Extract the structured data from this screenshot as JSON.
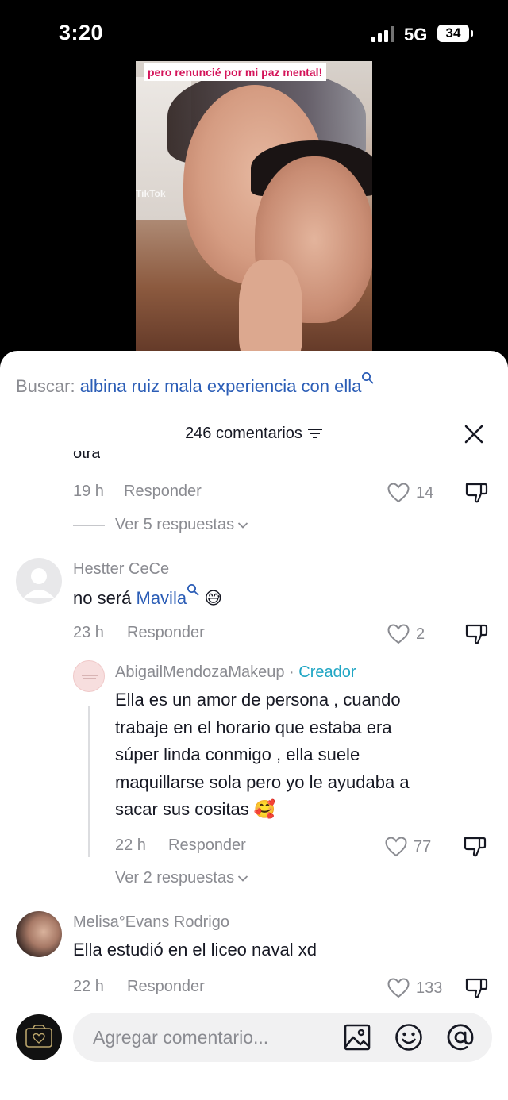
{
  "status_bar": {
    "time": "3:20",
    "network": "5G",
    "battery": "34"
  },
  "video": {
    "banner": "pero renuncié por mi paz mental!",
    "watermark": "TikTok"
  },
  "search": {
    "prefix": "Buscar: ",
    "query": "albina ruiz mala experiencia con ella"
  },
  "header": {
    "count_label": "246 comentarios"
  },
  "comments": {
    "prev": {
      "cut_text": "otra",
      "time": "19 h",
      "reply_label": "Responder",
      "likes": "14",
      "view_replies": "Ver 5 respuestas"
    },
    "c1": {
      "username": "Hestter CeCe",
      "text_before": "no será ",
      "mention": "Mavila",
      "emoji": "😅",
      "time": "23 h",
      "reply_label": "Responder",
      "likes": "2"
    },
    "reply": {
      "username": "AbigailMendozaMakeup",
      "separator": " · ",
      "badge": "Creador",
      "lines": [
        "Ella es un amor de persona , cuando",
        "trabaje en el horario que estaba era",
        "súper linda conmigo , ella suele",
        "maquillarse sola pero yo le ayudaba a",
        "sacar sus cositas"
      ],
      "emoji": "🥰",
      "time": "22 h",
      "reply_label": "Responder",
      "likes": "77",
      "view_replies": "Ver 2 respuestas"
    },
    "c2": {
      "username": "Melisa°Evans Rodrigo",
      "text": "Ella estudió en el liceo naval xd",
      "time": "22 h",
      "reply_label": "Responder",
      "likes": "133"
    }
  },
  "composer": {
    "placeholder": "Agregar comentario...",
    "icons": [
      "image-icon",
      "emoji-icon",
      "mention-icon"
    ]
  },
  "colors": {
    "link": "#2b5db6",
    "creator_badge": "#20a6c4",
    "muted": "#8a8b91",
    "text": "#161823"
  }
}
